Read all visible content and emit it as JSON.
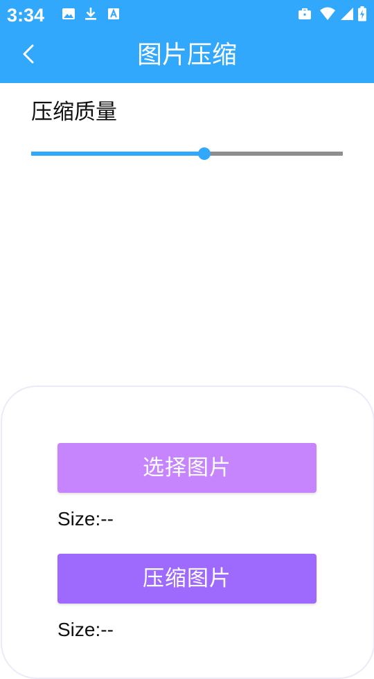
{
  "status_bar": {
    "time": "3:34",
    "left_icons": [
      "image-icon",
      "download-icon",
      "a-font-icon"
    ],
    "right_icons": [
      "briefcase-icon",
      "wifi-icon",
      "signal-icon",
      "battery-charging-icon"
    ]
  },
  "app_bar": {
    "title": "图片压缩",
    "back_icon": "chevron-left-icon"
  },
  "quality": {
    "label": "压缩质量",
    "value_fraction": 0.556
  },
  "actions": {
    "select_label": "选择图片",
    "original_size": "Size:--",
    "compress_label": "压缩图片",
    "compressed_size": "Size:--"
  },
  "colors": {
    "primary": "#31a8fb",
    "select_button": "#c685fd",
    "compress_button": "#9e6afe",
    "slider_inactive": "#8e8e8e"
  }
}
